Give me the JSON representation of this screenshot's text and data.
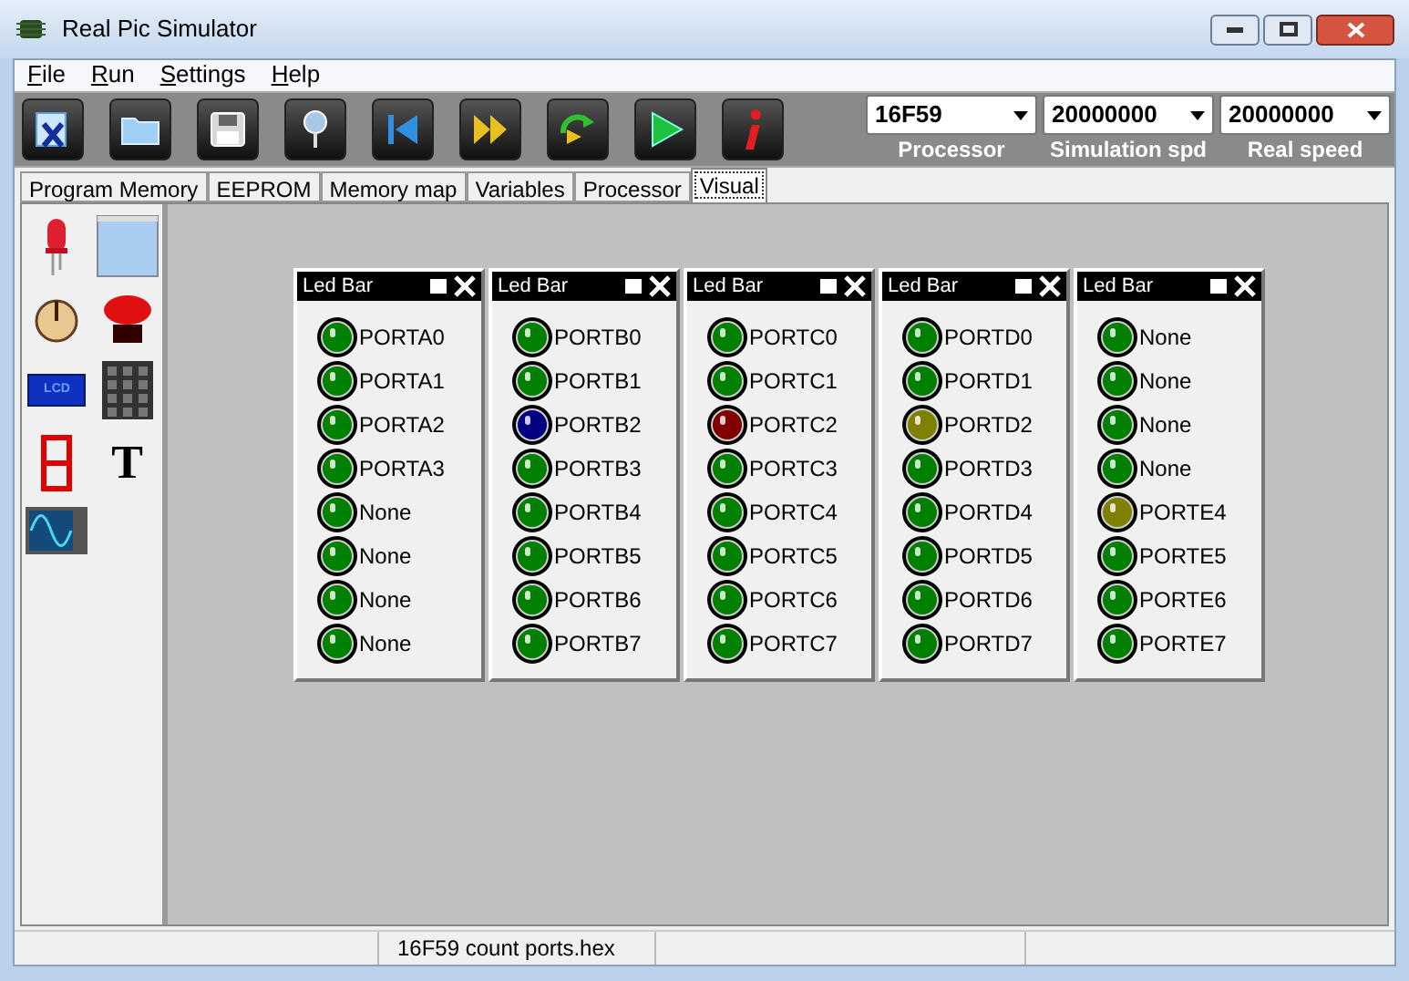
{
  "window": {
    "title": "Real Pic Simulator"
  },
  "menu": [
    {
      "label": "File"
    },
    {
      "label": "Run"
    },
    {
      "label": "Settings"
    },
    {
      "label": "Help"
    }
  ],
  "toolbar": {
    "buttons": [
      {
        "kind": "close"
      },
      {
        "kind": "open"
      },
      {
        "kind": "save"
      },
      {
        "kind": "pin"
      },
      {
        "kind": "reset"
      },
      {
        "kind": "step"
      },
      {
        "kind": "reload"
      },
      {
        "kind": "run"
      },
      {
        "kind": "info"
      }
    ],
    "selectors": [
      {
        "value": "16F59",
        "caption": "Processor"
      },
      {
        "value": "20000000",
        "caption": "Simulation spd"
      },
      {
        "value": "20000000",
        "caption": "Real speed"
      }
    ]
  },
  "tabs": [
    {
      "label": "Program Memory",
      "selected": false
    },
    {
      "label": "EEPROM",
      "selected": false
    },
    {
      "label": "Memory map",
      "selected": false
    },
    {
      "label": "Variables",
      "selected": false
    },
    {
      "label": "Processor",
      "selected": false
    },
    {
      "label": "Visual",
      "selected": true
    }
  ],
  "palette": [
    {
      "kind": "led"
    },
    {
      "kind": "terminal"
    },
    {
      "kind": "knob"
    },
    {
      "kind": "pushbutton"
    },
    {
      "kind": "lcd",
      "label": "LCD"
    },
    {
      "kind": "keypad"
    },
    {
      "kind": "seven-segment"
    },
    {
      "kind": "text",
      "glyph": "T"
    },
    {
      "kind": "oscilloscope"
    }
  ],
  "led_bars": [
    {
      "title": "Led Bar",
      "leds": [
        {
          "label": "PORTA0",
          "color": "#008000"
        },
        {
          "label": "PORTA1",
          "color": "#008000"
        },
        {
          "label": "PORTA2",
          "color": "#008000"
        },
        {
          "label": "PORTA3",
          "color": "#008000"
        },
        {
          "label": "None",
          "color": "#008000"
        },
        {
          "label": "None",
          "color": "#008000"
        },
        {
          "label": "None",
          "color": "#008000"
        },
        {
          "label": "None",
          "color": "#008000"
        }
      ]
    },
    {
      "title": "Led Bar",
      "leds": [
        {
          "label": "PORTB0",
          "color": "#008000"
        },
        {
          "label": "PORTB1",
          "color": "#008000"
        },
        {
          "label": "PORTB2",
          "color": "#000080"
        },
        {
          "label": "PORTB3",
          "color": "#008000"
        },
        {
          "label": "PORTB4",
          "color": "#008000"
        },
        {
          "label": "PORTB5",
          "color": "#008000"
        },
        {
          "label": "PORTB6",
          "color": "#008000"
        },
        {
          "label": "PORTB7",
          "color": "#008000"
        }
      ]
    },
    {
      "title": "Led Bar",
      "leds": [
        {
          "label": "PORTC0",
          "color": "#008000"
        },
        {
          "label": "PORTC1",
          "color": "#008000"
        },
        {
          "label": "PORTC2",
          "color": "#800000"
        },
        {
          "label": "PORTC3",
          "color": "#008000"
        },
        {
          "label": "PORTC4",
          "color": "#008000"
        },
        {
          "label": "PORTC5",
          "color": "#008000"
        },
        {
          "label": "PORTC6",
          "color": "#008000"
        },
        {
          "label": "PORTC7",
          "color": "#008000"
        }
      ]
    },
    {
      "title": "Led Bar",
      "leds": [
        {
          "label": "PORTD0",
          "color": "#008000"
        },
        {
          "label": "PORTD1",
          "color": "#008000"
        },
        {
          "label": "PORTD2",
          "color": "#808000"
        },
        {
          "label": "PORTD3",
          "color": "#008000"
        },
        {
          "label": "PORTD4",
          "color": "#008000"
        },
        {
          "label": "PORTD5",
          "color": "#008000"
        },
        {
          "label": "PORTD6",
          "color": "#008000"
        },
        {
          "label": "PORTD7",
          "color": "#008000"
        }
      ]
    },
    {
      "title": "Led Bar",
      "leds": [
        {
          "label": "None",
          "color": "#008000"
        },
        {
          "label": "None",
          "color": "#008000"
        },
        {
          "label": "None",
          "color": "#008000"
        },
        {
          "label": "None",
          "color": "#008000"
        },
        {
          "label": "PORTE4",
          "color": "#808000"
        },
        {
          "label": "PORTE5",
          "color": "#008000"
        },
        {
          "label": "PORTE6",
          "color": "#008000"
        },
        {
          "label": "PORTE7",
          "color": "#008000"
        }
      ]
    }
  ],
  "status_bar": {
    "file": "16F59 count ports.hex"
  }
}
